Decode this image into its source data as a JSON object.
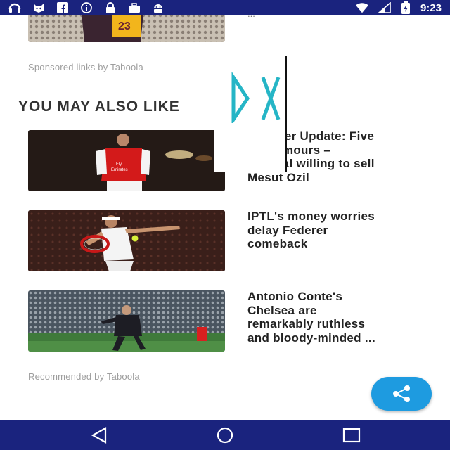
{
  "status_bar": {
    "time": "9:23",
    "left_icons": [
      "headset-icon",
      "cat-icon",
      "facebook-icon",
      "info-icon",
      "lock-icon",
      "briefcase-icon",
      "android-icon"
    ],
    "right_icons": [
      "wifi-icon",
      "signal-icon",
      "battery-icon"
    ]
  },
  "sponsored_label": "Sponsored links by Taboola",
  "section_title": "YOU MAY ALSO LIKE",
  "articles": [
    {
      "headline": "Transfer Update: Five\nhot rumours –\nArsenal willing to sell\nMesut Ozil"
    },
    {
      "headline": "IPTL's money worries\ndelay Federer\ncomeback"
    },
    {
      "headline": "Antonio Conte's\nChelsea are\nremarkably ruthless\nand bloody-minded ..."
    }
  ],
  "recommended_label": "Recommended by Taboola",
  "top_partial_text": "...",
  "fab": {
    "icon": "share-icon"
  },
  "nav_bar": {
    "buttons": [
      "back-icon",
      "home-icon",
      "recents-icon"
    ]
  },
  "colors": {
    "status_bar": "#1a237e",
    "fab": "#1e9be0",
    "ad_glyph": "#25b5c6"
  }
}
